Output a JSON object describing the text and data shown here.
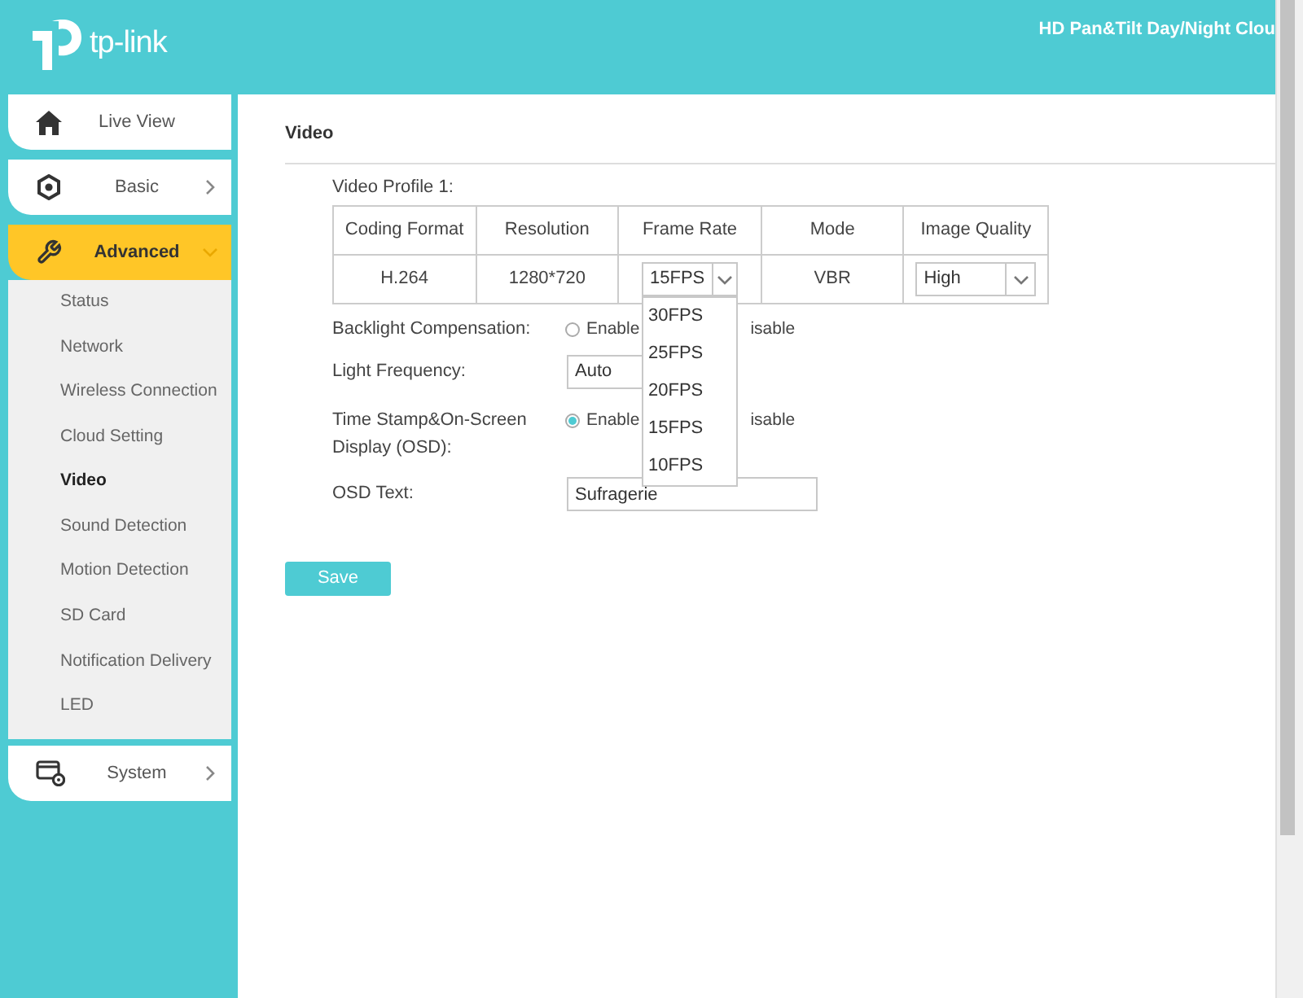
{
  "header": {
    "logo": "tp-link",
    "product_title": "HD Pan&Tilt Day/Night Clou"
  },
  "sidebar": {
    "items": [
      {
        "label": "Live View",
        "kind": "link",
        "selected": false
      },
      {
        "label": "Basic",
        "kind": "group",
        "selected": false,
        "expanded": false
      },
      {
        "label": "Advanced",
        "kind": "group",
        "selected": true,
        "expanded": true,
        "children": [
          {
            "label": "Status",
            "selected": false
          },
          {
            "label": "Network",
            "selected": false
          },
          {
            "label": "Wireless Connection",
            "selected": false
          },
          {
            "label": "Cloud Setting",
            "selected": false
          },
          {
            "label": "Video",
            "selected": true
          },
          {
            "label": "Sound Detection",
            "selected": false
          },
          {
            "label": "Motion Detection",
            "selected": false
          },
          {
            "label": "SD Card",
            "selected": false
          },
          {
            "label": "Notification Delivery",
            "selected": false
          },
          {
            "label": "LED",
            "selected": false
          }
        ]
      },
      {
        "label": "System",
        "kind": "group",
        "selected": false,
        "expanded": false
      }
    ]
  },
  "page": {
    "title": "Video",
    "profile_label": "Video Profile 1:",
    "table": {
      "columns": [
        "Coding Format",
        "Resolution",
        "Frame Rate",
        "Mode",
        "Image Quality"
      ],
      "row": [
        {
          "kind": "text",
          "value": "H.264"
        },
        {
          "kind": "text",
          "value": "1280*720"
        },
        {
          "kind": "select",
          "value": "15FPS",
          "open": true
        },
        {
          "kind": "text",
          "value": "VBR"
        },
        {
          "kind": "select",
          "value": "High",
          "open": false
        }
      ]
    },
    "frame_rate_options": [
      "30FPS",
      "25FPS",
      "20FPS",
      "15FPS",
      "10FPS"
    ],
    "fields": [
      {
        "label": "Backlight Compensation:",
        "kind": "radio",
        "options": [
          {
            "label": "Enable",
            "selected": false
          },
          {
            "label": "isable"
          }
        ]
      },
      {
        "label": "Light Frequency:",
        "kind": "select",
        "value": "Auto"
      },
      {
        "label": "Time Stamp&On-Screen Display (OSD):",
        "kind": "radio",
        "options": [
          {
            "label": "Enable",
            "selected": true
          },
          {
            "label": "isable"
          }
        ]
      },
      {
        "label": "OSD Text:",
        "kind": "text",
        "value": "Sufragerie"
      }
    ],
    "save_button": "Save"
  }
}
